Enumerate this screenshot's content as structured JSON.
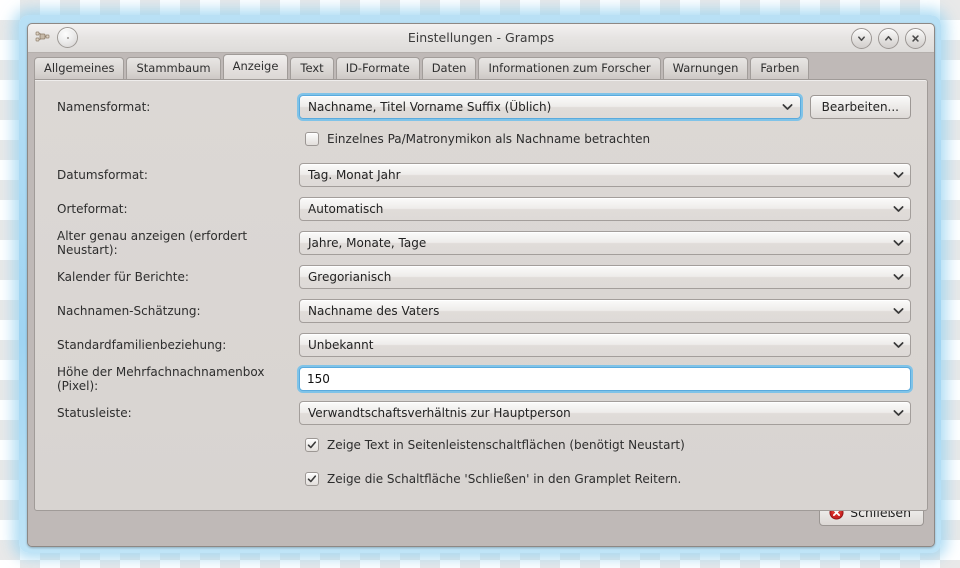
{
  "window": {
    "title": "Einstellungen - Gramps",
    "icons": {
      "app_icon": "gramps-app-icon",
      "menu_button": "window-menu-button",
      "minimize": "chevron-down-icon",
      "maximize": "chevron-up-icon",
      "close": "close-x-icon"
    }
  },
  "tabs": [
    {
      "label": "Allgemeines",
      "active": false
    },
    {
      "label": "Stammbaum",
      "active": false
    },
    {
      "label": "Anzeige",
      "active": true
    },
    {
      "label": "Text",
      "active": false
    },
    {
      "label": "ID-Formate",
      "active": false
    },
    {
      "label": "Daten",
      "active": false
    },
    {
      "label": "Informationen zum Forscher",
      "active": false
    },
    {
      "label": "Warnungen",
      "active": false
    },
    {
      "label": "Farben",
      "active": false
    }
  ],
  "form": {
    "name_format": {
      "label": "Namensformat:",
      "value": "Nachname, Titel Vorname Suffix (Üblich)",
      "edit_button": "Bearbeiten..."
    },
    "patronymic_checkbox": {
      "label": "Einzelnes Pa/Matronymikon als Nachname betrachten",
      "checked": false
    },
    "date_format": {
      "label": "Datumsformat:",
      "value": "Tag. Monat Jahr"
    },
    "place_format": {
      "label": "Orteformat:",
      "value": "Automatisch"
    },
    "age_precision": {
      "label": "Alter genau anzeigen (erfordert Neustart):",
      "value": "Jahre, Monate, Tage"
    },
    "report_calendar": {
      "label": "Kalender für Berichte:",
      "value": "Gregorianisch"
    },
    "surname_guess": {
      "label": "Nachnamen-Schätzung:",
      "value": "Nachname des Vaters"
    },
    "default_family_relationship": {
      "label": "Standardfamilienbeziehung:",
      "value": "Unbekannt"
    },
    "multiple_surname_box_height": {
      "label": "Höhe der Mehrfachnachnamenbox (Pixel):",
      "value": "150",
      "placeholder": ""
    },
    "statusbar": {
      "label": "Statusleiste:",
      "value": "Verwandtschaftsverhältnis zur Hauptperson"
    },
    "sidebar_text_checkbox": {
      "label": "Zeige Text in Seitenleistenschaltflächen (benötigt Neustart)",
      "checked": true
    },
    "gramplet_close_checkbox": {
      "label": "Zeige die Schaltfläche 'Schließen' in den Gramplet Reitern.",
      "checked": true
    }
  },
  "footer": {
    "close_label": "Schließen",
    "close_icon": "close-error-icon"
  },
  "colors": {
    "window_bg": "#bfb9b7",
    "panel_bg": "#dcd8d5",
    "focus_blue": "#5aaadd",
    "close_icon_red": "#cc2222"
  }
}
